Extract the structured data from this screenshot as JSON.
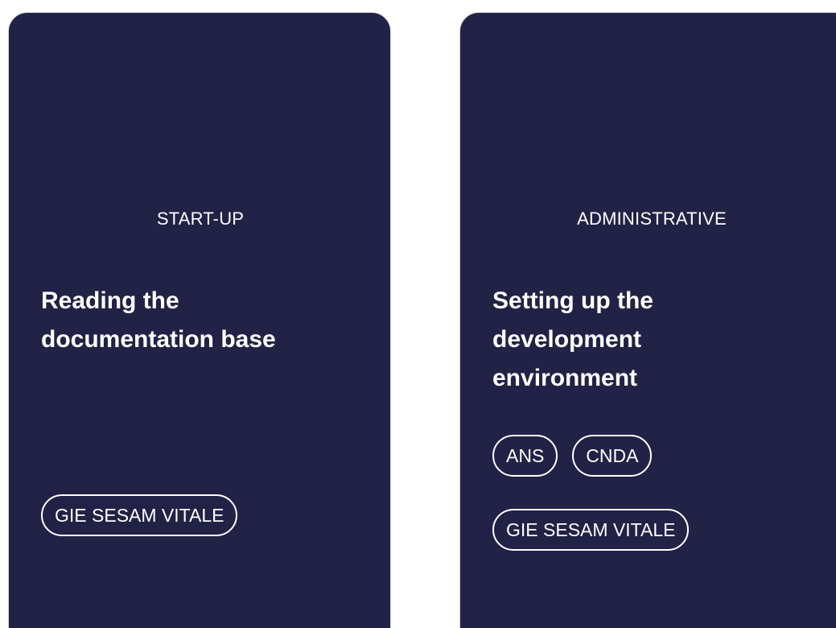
{
  "cards": [
    {
      "category": "START-UP",
      "title": "Reading the documentation base",
      "tags": [
        "GIE SESAM VITALE"
      ]
    },
    {
      "category": "ADMINISTRATIVE",
      "title": "Setting up the development environment",
      "tags": [
        "ANS",
        "CNDA",
        "GIE SESAM VITALE"
      ]
    }
  ],
  "colors": {
    "card_background": "#212245",
    "text": "#ffffff",
    "page_background": "#ffffff"
  }
}
